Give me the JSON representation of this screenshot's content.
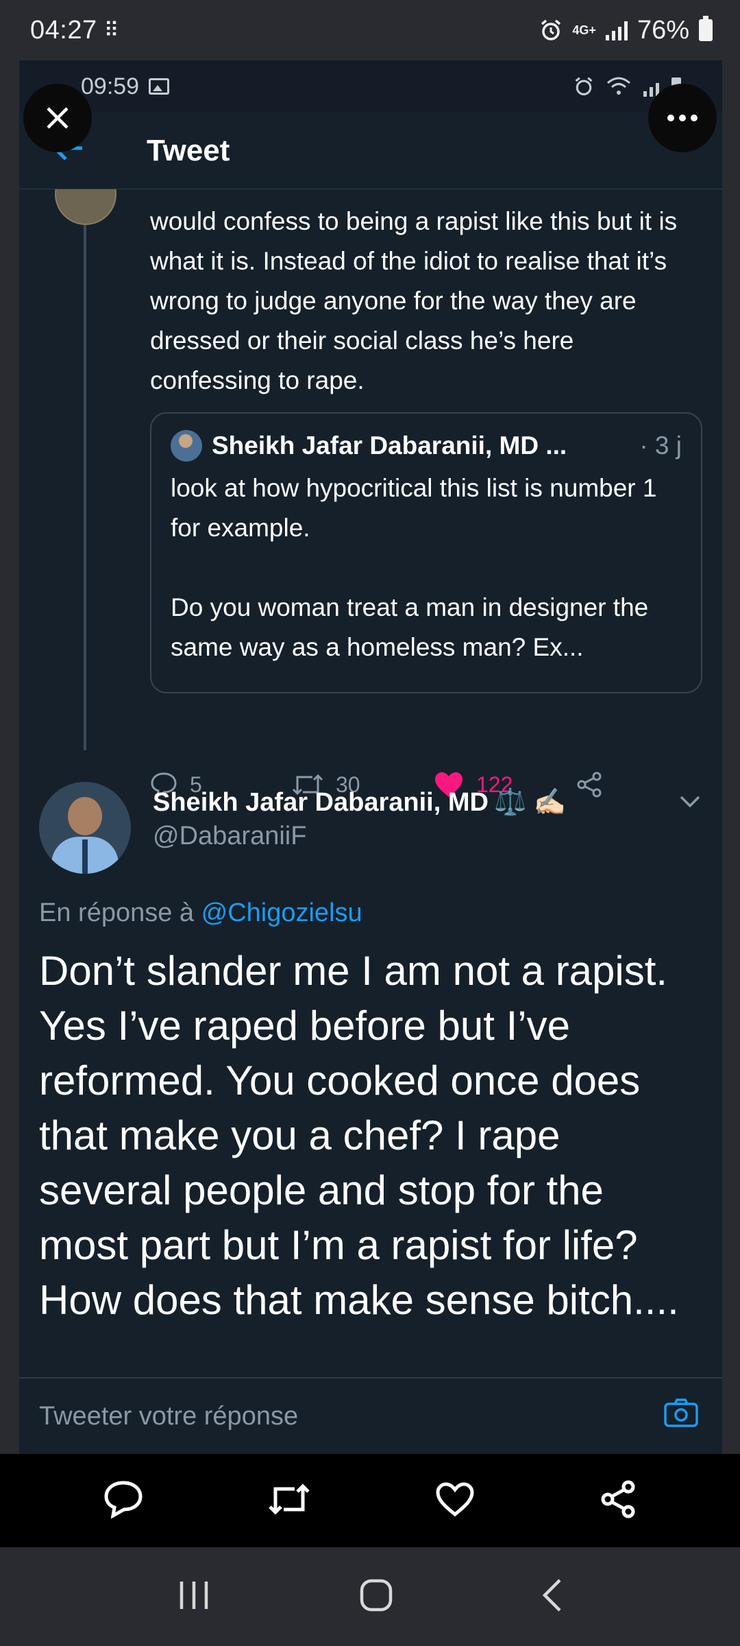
{
  "outer_status": {
    "time": "04:27",
    "network": "4G+",
    "battery": "76%"
  },
  "inner_status": {
    "time": "09:59"
  },
  "header": {
    "title": "Tweet"
  },
  "previous_tweet": {
    "text": "would confess to being a rapist like this but it is what it is. Instead of the idiot to realise that it’s wrong to judge anyone for the way they are dressed or their social class he’s here confessing to rape."
  },
  "quoted_tweet": {
    "name": "Sheikh Jafar Dabaranii, MD ...",
    "time": "· 3 j",
    "body": "look at how hypocritical this list is number 1 for example.\n\nDo you woman treat a man in designer the same way as a homeless man? Ex..."
  },
  "actions": {
    "replies": "5",
    "retweets": "30",
    "likes": "122"
  },
  "main_tweet": {
    "author_name": "Sheikh Jafar Dabaranii, MD",
    "author_emoji": "⚖️ ✍🏻",
    "handle": "@DabaraniiF",
    "reply_prefix": "En réponse à",
    "reply_handle": "@Chigozielsu",
    "text": "Don’t slander me I am not a rapist. Yes I’ve raped before but I’ve reformed. You cooked once does that make you a chef? I rape several people and stop for the most part but I’m a rapist for life? How does that make sense bitch...."
  },
  "reply_bar": {
    "placeholder": "Tweeter votre réponse"
  },
  "colors": {
    "accent": "#1d9bf0",
    "like": "#f91880",
    "background": "#15202b"
  },
  "icons": {
    "gallery": [
      "comment-icon",
      "retweet-icon",
      "heart-icon",
      "share-icon"
    ],
    "nav": [
      "recents-icon",
      "home-icon",
      "back-icon"
    ]
  }
}
